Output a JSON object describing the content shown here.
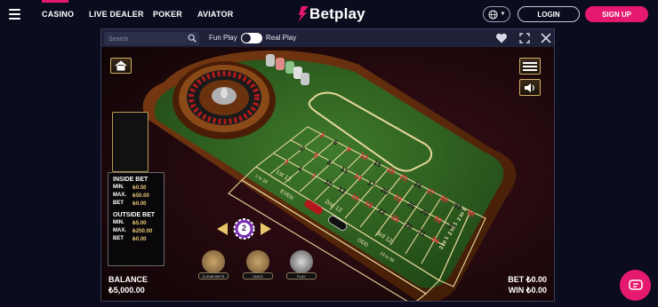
{
  "nav": {
    "items": [
      {
        "label": "CASINO"
      },
      {
        "label": "LIVE DEALER"
      },
      {
        "label": "POKER"
      },
      {
        "label": "AVIATOR"
      }
    ],
    "logo_text": "Betplay",
    "login_label": "LOGIN",
    "signup_label": "SIGN UP",
    "language_icon": "globe-icon",
    "accent_color": "#e5196e"
  },
  "game_header": {
    "search_placeholder": "Search",
    "fun_play_label": "Fun Play",
    "real_play_label": "Real Play",
    "fun_play_active": true
  },
  "game": {
    "inside_bet": {
      "title": "INSIDE BET",
      "min_label": "MIN.",
      "min": "₺0.50",
      "max_label": "MAX.",
      "max": "₺50.00",
      "bet_label": "BET",
      "bet": "₺0.00"
    },
    "outside_bet": {
      "title": "OUTSIDE BET",
      "min_label": "MIN.",
      "min": "₺5.00",
      "max_label": "MAX.",
      "max": "₺250.00",
      "bet_label": "BET",
      "bet": "₺0.00"
    },
    "balance_label": "BALANCE",
    "balance_value": "₺5,000.00",
    "bet_label": "BET",
    "bet_value": "₺0.00",
    "win_label": "WIN",
    "win_value": "₺0.00",
    "selected_chip": "2",
    "actions": [
      {
        "label": "CLEAR BETS"
      },
      {
        "label": "UNDO"
      },
      {
        "label": "PLAY"
      }
    ],
    "table_labels": {
      "first_12": "1st 12",
      "second_12": "2nd 12",
      "third_12": "3rd 12",
      "low": "1 to 18",
      "even": "EVEN",
      "odd": "ODD",
      "high": "19 to 36",
      "column": "2 to 1"
    },
    "grid_rows": [
      [
        "3",
        "6",
        "9",
        "12",
        "15",
        "18",
        "21",
        "24",
        "27",
        "30",
        "33",
        "36"
      ],
      [
        "2",
        "5",
        "8",
        "11",
        "14",
        "17",
        "20",
        "23",
        "26",
        "29",
        "32",
        "35"
      ],
      [
        "1",
        "4",
        "7",
        "10",
        "13",
        "16",
        "19",
        "22",
        "25",
        "28",
        "31",
        "34"
      ]
    ],
    "red_numbers": [
      "1",
      "3",
      "5",
      "7",
      "9",
      "12",
      "14",
      "16",
      "18",
      "19",
      "21",
      "23",
      "25",
      "27",
      "30",
      "32",
      "34",
      "36"
    ]
  }
}
